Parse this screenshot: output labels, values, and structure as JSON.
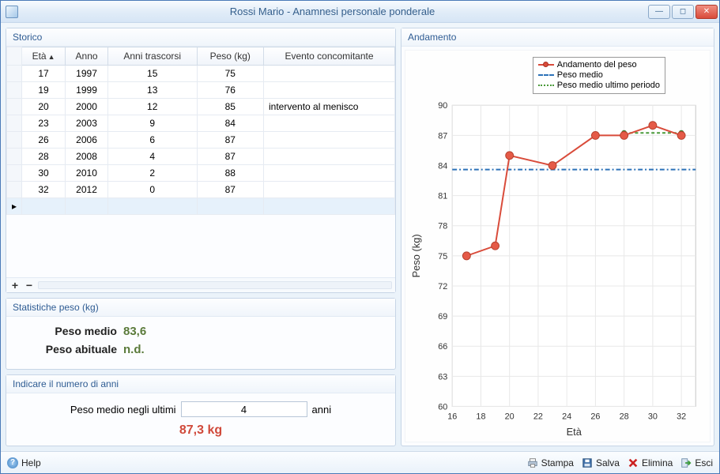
{
  "window": {
    "title": "Rossi Mario - Anamnesi personale ponderale"
  },
  "storico": {
    "header": "Storico",
    "columns": {
      "eta": "Età",
      "anno": "Anno",
      "anni_trascorsi": "Anni trascorsi",
      "peso": "Peso (kg)",
      "evento": "Evento concomitante"
    },
    "rows": [
      {
        "eta": "17",
        "anno": "1997",
        "trascorsi": "15",
        "peso": "75",
        "evento": ""
      },
      {
        "eta": "19",
        "anno": "1999",
        "trascorsi": "13",
        "peso": "76",
        "evento": ""
      },
      {
        "eta": "20",
        "anno": "2000",
        "trascorsi": "12",
        "peso": "85",
        "evento": "intervento al menisco"
      },
      {
        "eta": "23",
        "anno": "2003",
        "trascorsi": "9",
        "peso": "84",
        "evento": ""
      },
      {
        "eta": "26",
        "anno": "2006",
        "trascorsi": "6",
        "peso": "87",
        "evento": ""
      },
      {
        "eta": "28",
        "anno": "2008",
        "trascorsi": "4",
        "peso": "87",
        "evento": ""
      },
      {
        "eta": "30",
        "anno": "2010",
        "trascorsi": "2",
        "peso": "88",
        "evento": ""
      },
      {
        "eta": "32",
        "anno": "2012",
        "trascorsi": "0",
        "peso": "87",
        "evento": ""
      }
    ],
    "add_label": "+",
    "remove_label": "−"
  },
  "statistiche": {
    "header": "Statistiche peso (kg)",
    "peso_medio_label": "Peso medio",
    "peso_medio_value": "83,6",
    "peso_abituale_label": "Peso abituale",
    "peso_abituale_value": "n.d."
  },
  "periodo": {
    "header": "Indicare il numero di anni",
    "prefix": "Peso medio negli ultimi",
    "value": "4",
    "suffix": "anni",
    "result": "87,3 kg"
  },
  "andamento": {
    "header": "Andamento",
    "legend": {
      "series": "Andamento del peso",
      "mean": "Peso medio",
      "recent": "Peso medio ultimo periodo"
    },
    "xlabel": "Età",
    "ylabel": "Peso (kg)"
  },
  "chart_data": {
    "type": "line",
    "xlabel": "Età",
    "ylabel": "Peso (kg)",
    "xlim": [
      16,
      33
    ],
    "ylim": [
      60,
      90
    ],
    "xticks": [
      16,
      18,
      20,
      22,
      24,
      26,
      28,
      30,
      32
    ],
    "yticks": [
      60,
      63,
      66,
      69,
      72,
      75,
      78,
      81,
      84,
      87,
      90
    ],
    "series": [
      {
        "name": "Andamento del peso",
        "x": [
          17,
          19,
          20,
          23,
          26,
          28,
          30,
          32
        ],
        "y": [
          75,
          76,
          85,
          84,
          87,
          87,
          88,
          87
        ]
      }
    ],
    "mean": 83.6,
    "recent_mean": {
      "value": 87.25,
      "from_x": 28,
      "to_x": 32
    }
  },
  "footer": {
    "help": "Help",
    "stampa": "Stampa",
    "salva": "Salva",
    "elimina": "Elimina",
    "esci": "Esci"
  }
}
